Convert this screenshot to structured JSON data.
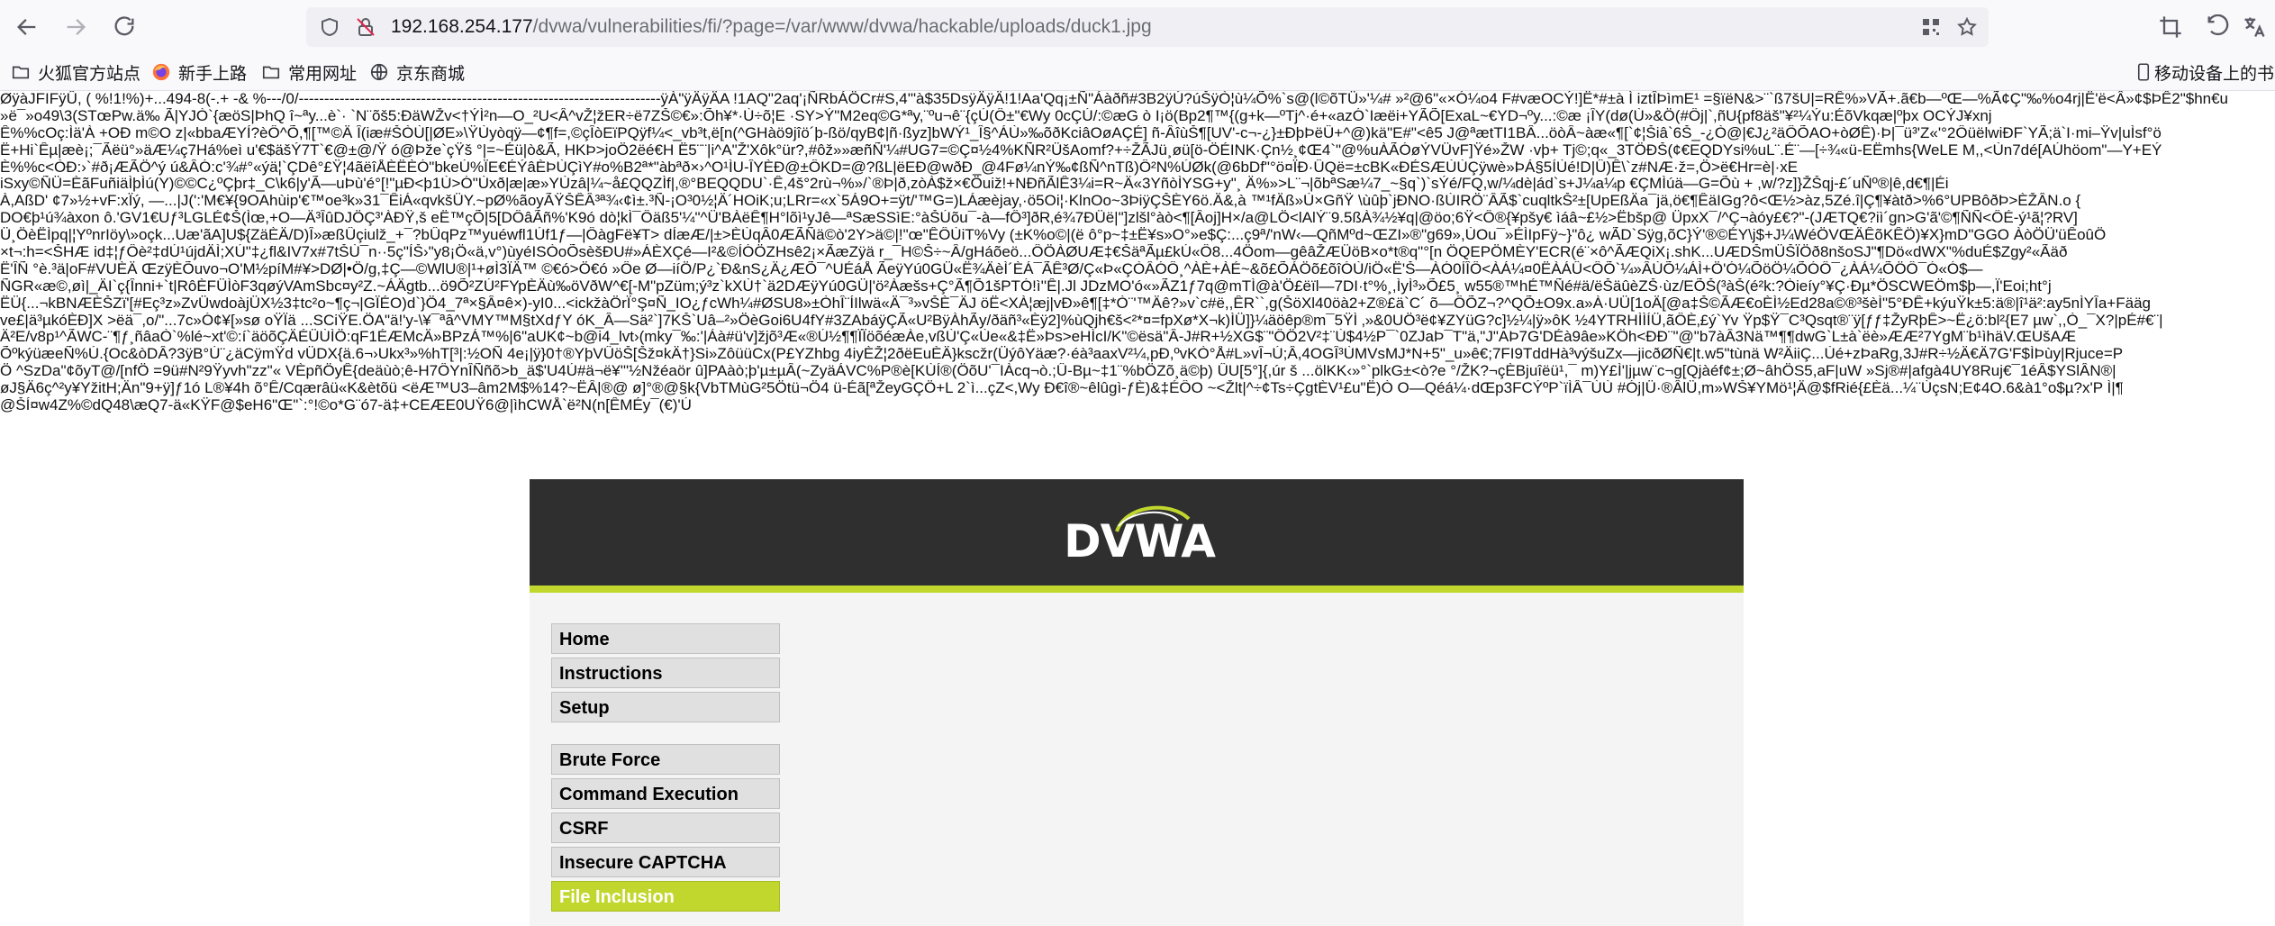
{
  "browser": {
    "url": {
      "host": "192.168.254.177",
      "path": "/dvwa/vulnerabilities/fi/?page=/var/www/dvwa/hackable/uploads/duck1.jpg"
    },
    "icons": [
      "back-icon",
      "forward-icon",
      "reload-icon",
      "shield-icon",
      "insecure-lock-icon",
      "qr-code-icon",
      "star-icon",
      "crop-icon",
      "undo-icon",
      "translate-icon"
    ]
  },
  "bookmarks": {
    "items": [
      {
        "label": "火狐官方站点",
        "icon": "folder-icon"
      },
      {
        "label": "新手上路",
        "icon": "firefox-icon"
      },
      {
        "label": "常用网址",
        "icon": "folder-icon"
      },
      {
        "label": "京东商城",
        "icon": "globe-icon"
      }
    ],
    "mobile": "移动设备上的书"
  },
  "garbled_lines": [
    "ØÿàJFIFÿÛ, ( %!1!%)+...494-8(-.+ -& %---/0/-----------------------------------------------------------------------ÿÀ\"ÿÄÿÄA !1AQ\"2aq'¡ÑRbÁÖCr#S,4'\"à$35DsÿÄÿÄ!1!Aa'Qq¡±Ñ\"Áàðñ#3B2ÿÚ?úŠÿÒ¦ù¼Õ%`s@(l©õTÜ»'¼# »²@6\"«×Ó¼o4 F#væOCÝ!]Ë*#±à Ì iztÎÞìmE¹ =§ïëN&>¨`ß7šU|=RÊ%»VÃ+.ã€b—ºŒ—%Ã¢Ç\"‰%o4rj|Ë'ë<Â»¢$ÞÊ2\"$hn€u",
    "»ë¯»o49\\3(STœPw.ä‰ Ã|YJÒ`{æöS|ÞhQ î~ªy...è`· `N¨õš5:ÐäWŽv<†ÝÌ²n—O_²U<Â^vŽ¦žER÷ë7ZŠ©€»:Õh¥*·Ù÷õ¦E ·SY>Ý\"M2eq©G*ªy,¨ºu¬ê¨{çÚ(Ô±\"€Wy 0cÇÚ/:©æG ò I¡ö(Bp2¶™{(g+k—ºTj^·é+«azÓ`Iæëi+YÃÕ[ExaL~€YD¬ºy...:©æ ¡ÎY(dø(Ù»&Ö(#Ôj|`,ñU{pf8äš\"¥²¼Ýu:ÉõVkqæ|ºþx OCÝJ¥xnj",
    "Ê%%cOç:Ìä'À +OÐ m©O z|«bbaÆYÍ?èÔ^Õ,¶[™©Ä Î(iæ#ŠÒÙ[|ØE»\\ŸÙyòqÿ—¢¶f=,©çÎòEïPQÿf¼<_vb³t,ë[n(^GHàö9jîö´þ-ßö/qyB¢|ñ·ßyz]bWÝ¹_Î§^ÁÙ»‰õðKciâOøAÇÉ]  ñ-ÂîùŠ¶[UV'-c¬-¿}±ÐþÞëÛ+^@)kä\"E#\"<ê5 J@ªætTI1BÂ...öòÂ~àæ«¶[`¢¦Šiâ`6Š_-¿Ò@|€J¿²äÔÕAO+òØÊ)·Þ|¯ü³'Z«'°2ÔüëlwiÐF`YÃ;ä`I·mi–Ÿv|uÌsf°ö",
    "Ë+Hi`Êµ|æè¡;¯Ãëü°»äÆ¼ç7Há%eì u'€$äšÝ7T`€@±@/Ÿ ó@Þže`çŸš °|=~Éü|ò&Ã,  HKÞ>joÖ2ëé€H Ë5¨¨|i^A\"Ž'Xôk°ür?,#ôž»»æñÑ'¼#UG7=©Ç¤½4%KÑR²ÜšAomf?+÷ŽÃJü¸øü[ö-ÖÉINK·Çn½¸¢Œ4`\"@%uÀÃÓøÝVÜvF]Ÿé»ŽW ·vþ+ Tj©;q«_3TÖÐŠ(¢€EQDYsi%uL¨.É¨—[÷¾«ü-EËmhs{WeLE M,,<Ùn7dé[AÚhöom\"—Y+EÝ",
    "È%%c<ÒÐ:›`#ð¡ÆÃÖ^ý ú&ÂÓ:c'¾#°«ýä¦`ÇDê°£Ÿ¦4ãëîÅÈËÈÓ\"bkeÚ%ÏE€ÉÝâÈÞÙÇìY#o%B2ª*\"àbªð×›^O¹ÌU-ÎYÈÐ@±ÔKD=@?ßL|ëEÐ@wðÐ_@4Fø¼nÝ‰¢ßÑ^nTß)Ô²N%ÚØk(@6bDf\"°ö¤ÏÐ·ÛQë=±cBK«ÐÉSÆÙÙÇÿwè»ÞÁ§5ÍÙé!D|Û)Ê\\`z#NÆ·ž=,Ö>ë€Hr=è|·xE",
    "iSxy©ÑÜ=ÈãFuñiäÌþÌú(Y)©©C¿ºÇþr‡_C\\k6|y'Ã—uÞù'é°[!\"µÐ<þ1Ù>Ó\"Ùxð|æ|æ»YÙzâ|¼~å£QQZÌf|,®°BEQQDU`·Ê,4š°2rù¬%»/`®Þ|ð,zòÀ$ž×€Öuiž!+NÐñÃlÊ3¼i=R~Ä«3YñòÌYSG+y\"¸ Ä%»>L¨¬|õbªSæ¼7_~§q`)`sÝé/FQ,w/¼dè|ád`s+J¼a¼p €ÇMÌúä—G=Õù + ,w/?z]}ŽŠqj-£´uÑº®|ê,d€¶|Éi",
    "À,AßD' ¢7»½+vF:xÏý, —...|J(':'M€¥{9OAhùip'€™oe³k»31¯ÊiÁ«qvkšÜY.~pØ%ãoyÃŸŠÊÂ³ª¾‹¢ì±.³Ñ-¡O³0½¦Ä´HOiK;u;LRr=«x`5Á9O+=ÿt/'™G=)LÁæèjay,·ö5Oi¦·KlnOo~3ÞiÿÇŠÈY6ö.Ä&,à ™¹fÄß»Ù×GñŸ \\ùûþ`jÐNO·ßÙIRÖ¨ÂÃ$`cuqltkŠ²±[UpEßÄa¯jä,ö€¶ÊäIGg?ô<Œ½>àz,5Zé.î|Ç¶¥àtð>%6°UPBôðÞ>ÈŽÂN.o {",
    "DO€þ¹ú¾àxon ô.'GV1€Uƒ³LGLÉ¢Š(Ìœ,+O—Ä³ÎûDJÖÇ³'ÀÐŸ,š eË™çÕ|5[DÔâÃñ%'K9ó  dò¦kÌ¯Ôäß5'¼\"^Ü'BÀëÊ¶H°lõì¹yJê—ªSæSSìE:°àŠÚõu¯-à—fÔ³]ðR‚é¾7ÐÜë|\"]zlšl°àò<¶[Âoj]H×/a@LÖ<lAlÝ¨9.5ßÀ¾½¥q|@öo;6Ÿ<Ô®{¥pšy€ ìáâ~£½>Ëbšp@ ÜpxX¯/^Ç¬àóy£€?\"-(JÆTQ€?iì´gn>G'ã'©¶ÑÑ<ÔÉ-ý¹ã¦?RV]",
    "Ü¸ÖèËÌpq|¦YºnrIöy\\»oçk...Uæ'ãA]U${ZäÈÄ/D)Î»æßÛçiulž_+¯?bÛqPz™yuéwfl1Úf1ƒ—|ÔàgFë¥T> dÍæÆ/|±>ÈÙqÂ0ÆÃÑä©ò'2Y>ä©|!\"œ\"ÊÔÙiT%Vy (±K%o©|(ë ô°p~‡±Ë¥s»O°»e$Ç:...ç9ª/'nW‹—QñMºd~ŒZI»®\"g69»,ÙOu¯»ÉÌIpFÿ~}\"ô¿ wÃD`Sÿg,õC}Ý'®©ÉY\\j$+J¼WéÖVŒÄÊõKÊÖ)¥X}mD\"GGO ÀòÖÜ'üÊoûÖ",
    "×t¬:h=<ŠHÆ id‡¦ƒÔè²‡dÚ¹újdÄÌ;XÚ\"‡¿fl&IV7x#7tŠÙ¯n··5ç\"ÍŠ›\"y8¡Ö«ä,v°)ùyéISÒoÕsèšÐU#»ÁÈXÇé—I²&©ÍÓÖZHsê2¡×ÃæZÿä r_¯H©Š÷~Â/gHáõeö...ÔÖÀØUÆ‡€ŠäªÃµ£kÚ«Ô8...4Öom—gêâŽÆÜöB×o*t®q\"°[n ÖQEPÖMÈY'ECR(é¨×ô^ÃÆQiX¡.shK...UÆDŠmÜŠÏÖð8nšoSJ\"¶Dö«dWX\"%duÉ$Zgy²«Ãäð",
    "Ë'ÎÑ °è.³ä|oF#VUÈÄ ŒzÿÈÕuvo¬O'M½píM#¥>DØ|•Ö/g,‡Ç—©WlU®|¹+øÌ3ÏÄ™ ©€ó>Ö€ó »Ôe Ø—iíÖ/P¿`Ð&nS¿Ä¿ÆÕ¯^UÉáÅ ÃeÿYú0GÜ«Ë¾ÄèÌ´ÈÁ¯ÃÊ³Ø/Ç«Þ«ÇÒÂÓÔ¸^ÀÈ+ÀÉ~&õ£ÕÁÖõ£õîÓÙ/iÖ«Ë'Š—ÀÓ0ÍÎÔ<ÀÁ¼¤0ËÀÁÛ<ÔÕ`¼»ÂÙÕ¼ÁÌ+Ö'Ó¼ÕöÖ¼ÕÓÔ¯¿ÀÁ¼ÕÖÔ¯Ó«Ó$—",
    "ÑGR«æ©,øì|_ÄI`ç{Înni+`t|RôÈFÜÌòF3qøýVAmSbc¤y²Z.~ÁÄgtb...ö9Õ²ZÚ²FYpÈÄù‰öVðW^€[-M\"pZüm;ý³z`kXÙ†`ä2DÆÿYú0GÜ|'ö²Àæšs+Ç°Ã¶Õ1šPTÓ!ì''Ê|.Jl JDzMO'ó«»ÃZ1ƒ7q@mTÌ@à'Ö£ëïl—7DI·t°%¸,ÌyÌ³»Õ£5¸ w55®™hÉ™Ñé#ä/ëŠäûèZŠ·ùz/EÕŠ(³àŠ(é²k:?Òieíy°¥Ç·Ðµ*ÖSCWEÖm$þ—,Ï'Eoi;ht°j",
    "ËÜ{...¬kBNÆÈŠZï'[#Eç³z»ZvÜwdoàjÜX½3‡tc²o~¶ç¬|GÏÉO)d`}Ö4_7ª×§Â¤ê×)-yI0...<ickžàÖrÏ°Ş¤Ñ_IO¿ƒcWh¼#ØSU8»±ÒhÎ¨ÍIlwä«Ä¯³»vŠÈ¯ÄJ öË<XÀ¦æj|vÐ»ê¶[‡*Ò¨'™Äê?»v`c#ë,,ÊR``,g(ŠöXl40öà2+Z®£ä`C´ õ—ÔÕZ¬?^QÕ±O9x.a»À·UÜ[1oÄ[@a‡Š©ÃÆ€oÈÌ½Ed28a©®³šèÌ\"5°ÐÊ+kýuŸk±5:ä®|î¹ä²:ay5nÌYÎa+Fääg",
    "ve£|ä³µkóÈÐ]X >ëä¯,o/\"...7c»Ó¢¥[»sø oŸÏä ...SCiŸE.ÖA\"ä!'y-\\¥¯ªâ^VMY™M§tXdƒY óK_Â—Sä²`]7KŠ`Uâ–²»ÖèGoi6U4fY#3ZAbáÿÇÃ«U²BÿÀhÃy/ðäñ³«Èÿ2]%ùQjh€š<²*¤=fpXø*X¬k)ÌÜ]}¼äöêp®m¯5ŸÌ ‚»&0UÖ³ë¢¥ZYüG?c]½¼|ÿ»ôK ½4YTRHÌÌÍÜ,ãÔÈ‚£ý`Yv Ÿp$Ÿ¯C³Qsqt®¨ÿ[ƒƒ‡ŽyRþÊ>~Ë¿ö:bl²{E7 µw`,,Ò_¯X?|pÉ#€¨|",
    "Ä²E/v8p¹^ÃWC-¨¶ƒ¸ñâaÒ`%lé~xt'©:í`äöõÇÄÉÜÙÌÖ:qF1ÉÆMcÄ»BPzÁ™%|6\"aUK¢~b@i4_lvt›(mky¯‰:'|Áà#ü'v]žjõ³Æ«®Ú½¶¶ÏÏöõéæÀe,vßÙ'Ç«Ùe«&‡Ë»Þs>eHÌcI/K\"©ësä\"Â-J#R+½XG$¨\"ÔÖ2V²‡¨Ù$4½P¯`0ZJaÞ¯T\"ä,\"J\"AÞ7G'DÉà9âe»KÖh<ÐÐ¨\"@\"b7àÂ3Nä™¶¶dwG`L±à`ëè»ÆÆ²7YgM¨b¹ìhäV.ŒUšAÆ",
    "ÕºkýüæeÑ%Ú.{Oc&òDÂ?3ÿB°Ú¨¿äCÿmŸd vÜDX{ä.6¬›Ukx³»%hT[³|:½OÑ 4e¡|ÿ}0†®YþVÛöŠ[Šž¤kÄ†}Si»ZôüüCx(P£YZhbg 4iyÈŽ¦2ðëEuÈÄ}kscžr(ÜýôYäæ?·éà³aaxV²¼,pÐ,ºvKÒ°Å#L»vÎ¬Ú;Â,4OGÎ³ÙMVsMJ*N+5\"_u»ê€;7FI9TddHà³výšuZx—jicðØÑ€|t.w5\"tùnä W²ÄiiÇ...Ùé+zÞaRg,3J#R÷½Ä€Ä7G'F$ÌÞùy|Rjuce=P",
    "Ö ^SzDa\"¢õyT@/[nfÖ =9ü#N²9Ÿyvh\"zz\"« VÈpñÖyÊ{deäùò;ê-H7ÔYnÎÑñõ>b_ä$'U4Ú#ä¬ë¥'\"½Nžéaör û]PAàò;þ'µ±µÂ(~ZyäÁVC%P®è[KÙÍ®(ÖõU'¯IÀcq¬ò.;Û-Bµ~‡1¨%bÖZõ¸ä©þ) ÛU[5°]{,úr š ...ölKK‹»°`plkG±<ò?e °/ŽK?¬çÈBjuîëü¹,¯ m)Y£Ì'|jµw¨c¬g[Qjàéf¢±;Ø~âhÖS5,aF|uW »Sj®#|afgà4UY8Ruj€¯1éÂ$YSlÂN®|",
    "øJ§Ä6ç^²y¥YžitH;Än\"9+ÿ]ƒ1ó L®¥4h õ°Ê/Cqærâü«K&ètõü <ëÆ™U3–âm2M$%14?~ËÂ|®@ ø]°®@§k{VbTMùG²5Ötü¬Ö4 ü-Éã[ªŽeyGÇÖ+L 2`ì...çZ<,Wy Ð€î®~êlûgì-ƒÈ)&‡ÉÔO  ~<Žlt|^÷¢Ts÷ÇgtÈV¹£u\"Ë)Ò O—Qéá¼·dŒp3FCÝºP`ïÌÂ¯ÙÙ #Ój|Ü·®ÂlÜ,m»WŠ¥YMö¹¦Ä@$fRié{£Èä...¼¨ÙçsN;E¢4O.6&à1°o$µ?x'P Ì|¶",
    "@ŠÍ¤w4Z%©dQ48\\æQ7-ä«KŸF@$eH6\"Œ\"`:°!©o*G¨ó7-ä‡+CEÆE0UŸ6@|ìhCWÅ`ë²N(n[ÊMÉy¯(€)'Ú"
  ],
  "dvwa": {
    "logo": "DVWA",
    "menu_primary": [
      "Home",
      "Instructions",
      "Setup"
    ],
    "menu_vulns": [
      "Brute Force",
      "Command Execution",
      "CSRF",
      "Insecure CAPTCHA",
      "File Inclusion"
    ],
    "active": "File Inclusion",
    "colors": {
      "header": "#2f2f2f",
      "accent": "#c1d72e",
      "menu_bg": "#e0e0e0"
    }
  }
}
